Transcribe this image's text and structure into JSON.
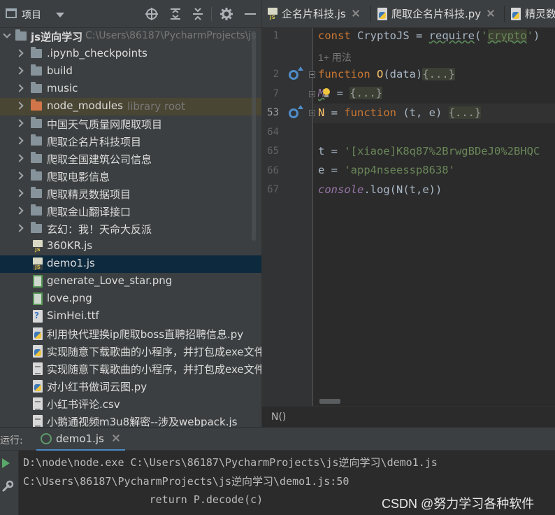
{
  "project_panel": {
    "title": "项目",
    "tree": [
      {
        "kind": "root",
        "label": "js逆向学习",
        "hint": "C:\\Users\\86187\\PycharmProjects\\js"
      },
      {
        "kind": "folder",
        "label": ".ipynb_checkpoints"
      },
      {
        "kind": "folder",
        "label": "build"
      },
      {
        "kind": "folder",
        "label": "music"
      },
      {
        "kind": "folder-lib",
        "label": "node_modules",
        "hint": "library root"
      },
      {
        "kind": "folder",
        "label": "中国天气质量网爬取项目"
      },
      {
        "kind": "folder",
        "label": "爬取企名片科技项目"
      },
      {
        "kind": "folder",
        "label": "爬取全国建筑公司信息"
      },
      {
        "kind": "folder",
        "label": "爬取电影信息"
      },
      {
        "kind": "folder",
        "label": "爬取精灵数据项目"
      },
      {
        "kind": "folder",
        "label": "爬取金山翻译接口"
      },
      {
        "kind": "folder",
        "label": "玄幻：我！天命大反派"
      },
      {
        "kind": "file-js",
        "label": "360KR.js"
      },
      {
        "kind": "file-js",
        "label": "demo1.js",
        "selected": true
      },
      {
        "kind": "file-png",
        "label": "generate_Love_star.png"
      },
      {
        "kind": "file-png",
        "label": "love.png"
      },
      {
        "kind": "file-ttf",
        "label": "SimHei.ttf"
      },
      {
        "kind": "file-py",
        "label": "利用快代理换ip爬取boss直聘招聘信息.py"
      },
      {
        "kind": "file-py",
        "label": "实现随意下载歌曲的小程序，并打包成exe文件"
      },
      {
        "kind": "file-txt",
        "label": "实现随意下载歌曲的小程序，并打包成exe文件"
      },
      {
        "kind": "file-py",
        "label": "对小红书做词云图.py"
      },
      {
        "kind": "file-csv",
        "label": "小红书评论.csv"
      },
      {
        "kind": "file-txt",
        "label": "小鹅通视频m3u8解密--涉及webpack.js"
      }
    ]
  },
  "editor": {
    "tabs": [
      {
        "label": "企名片科技.js",
        "icon": "js"
      },
      {
        "label": "爬取企名片科技.py",
        "icon": "py"
      },
      {
        "label": "精灵数",
        "icon": "py"
      }
    ],
    "usage_hint": "1+ 用法",
    "line_numbers": [
      "1",
      "2",
      "7",
      "53",
      "64",
      "65",
      "66",
      "67"
    ],
    "code": {
      "l1_const": "const ",
      "l1_var": "CryptoJS = ",
      "l1_require": "require",
      "l1_paren": "(",
      "l1_q": "'",
      "l1_str": "crypto",
      "l1_q2": "'",
      "l1_close": ")",
      "l2_kw": "function ",
      "l2_name": "O",
      "l2_params": "(data)",
      "folded": "{...}",
      "l7_glob": "M",
      "l7_eq": " = ",
      "l53_name": "N",
      "l53_eq": " = ",
      "l53_kw": "function ",
      "l53_params": "(t, e) ",
      "l65_lhs": "t = ",
      "l65_str": "'[xiaoe]K8q87%2BrwgBDeJ0%2BHQC",
      "l66_lhs": "e = ",
      "l66_str": "'app4nseessp8638'",
      "l67_obj": "console",
      "l67_dot": ".log(N(t,e))"
    },
    "breadcrumb": "N()"
  },
  "run_panel": {
    "label": "运行:",
    "tab": "demo1.js",
    "lines": [
      "D:\\node\\node.exe C:\\Users\\86187\\PycharmProjects\\js逆向学习\\demo1.js",
      "C:\\Users\\86187\\PycharmProjects\\js逆向学习\\demo1.js:50",
      "                    return P.decode(c)"
    ]
  },
  "watermark": "CSDN @努力学习各种软件",
  "colors": {
    "keyword": "#cc7832",
    "string": "#6a8759",
    "function": "#ffc66d",
    "global": "#9876aa",
    "selection": "#0d293e"
  }
}
